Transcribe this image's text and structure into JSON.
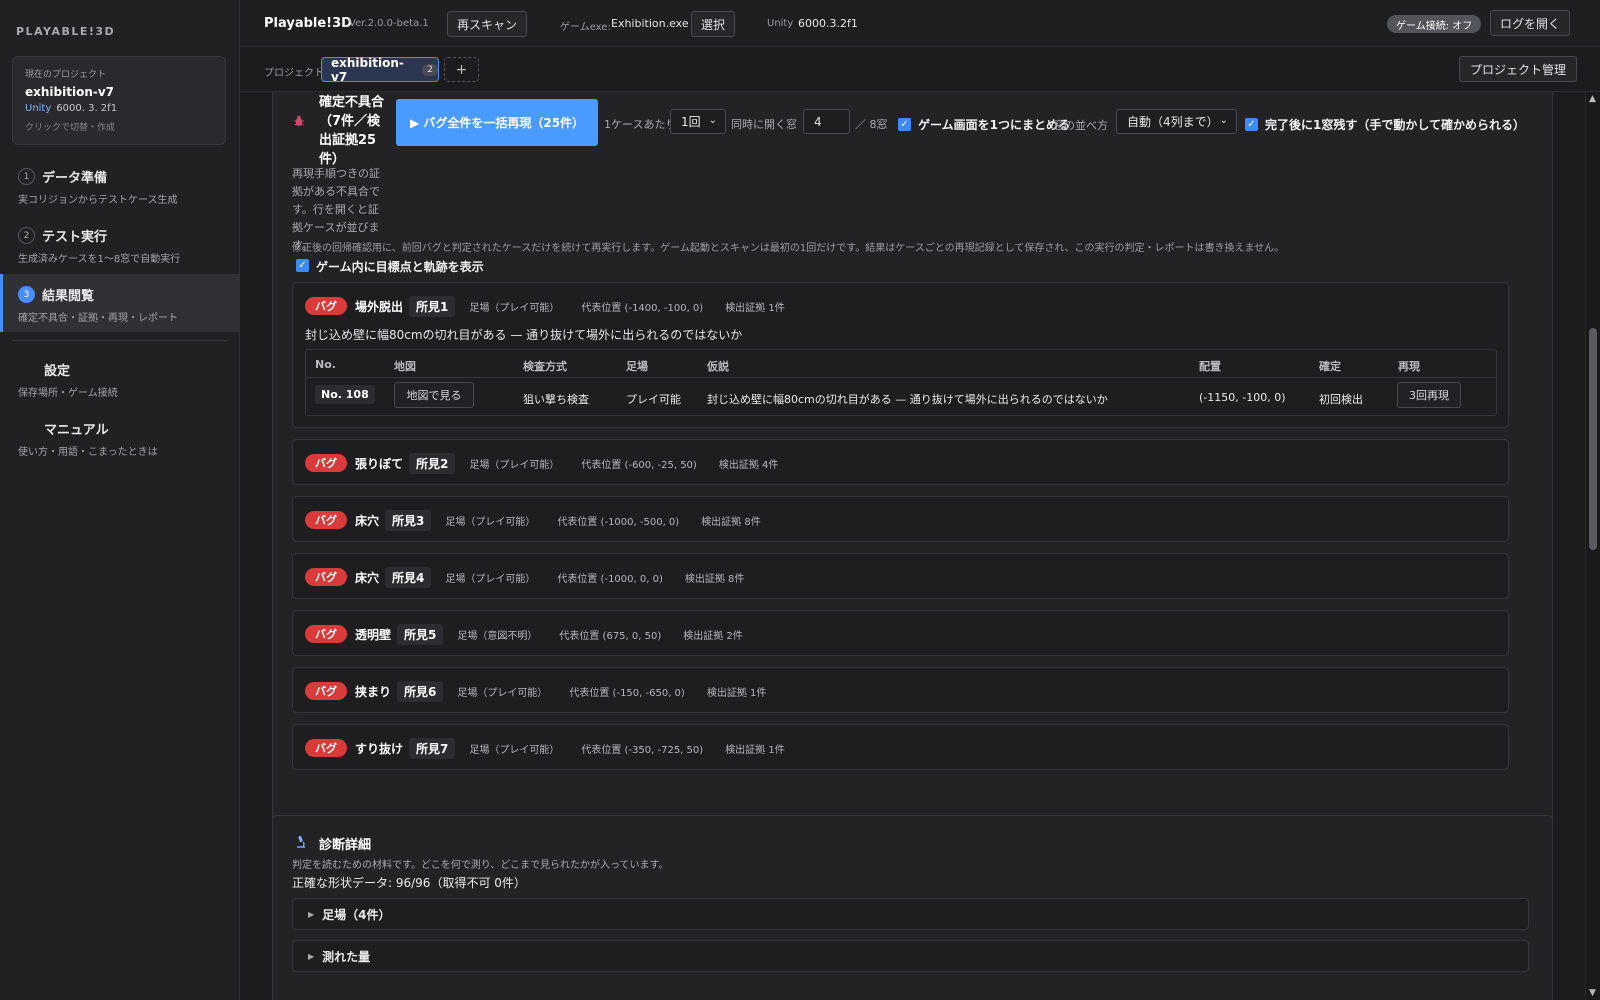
{
  "app": {
    "brand": "PLAYABLE!3D",
    "title": "Playable!3D",
    "version": "Ver.2.0.0-beta.1"
  },
  "header": {
    "rescan_label": "再スキャン",
    "game_exe_label": "ゲームexe:",
    "game_exe_value": "Exhibition.exe",
    "select_label": "選択",
    "unity_label": "Unity",
    "unity_value": "6000.3.2f1",
    "connection_badge": "ゲーム接続: オフ",
    "open_log_label": "ログを開く"
  },
  "project_card": {
    "caption": "現在のプロジェクト",
    "name": "exhibition-v7",
    "unity_label": "Unity",
    "unity_version": "6000. 3. 2f1",
    "hint": "クリックで切替・作成"
  },
  "nav": [
    {
      "num": "1",
      "title": "データ準備",
      "sub": "実コリジョンからテストケース生成"
    },
    {
      "num": "2",
      "title": "テスト実行",
      "sub": "生成済みケースを1〜8窓で自動実行"
    },
    {
      "num": "3",
      "title": "結果閲覧",
      "sub": "確定不具合・証拠・再現・レポート"
    },
    {
      "num": "",
      "title": "設定",
      "sub": "保存場所・ゲーム接続"
    },
    {
      "num": "",
      "title": "マニュアル",
      "sub": "使い方・用語・こまったときは"
    }
  ],
  "project_bar": {
    "label": "プロジェクト",
    "tab_name": "exhibition-v7",
    "tab_count": "2",
    "add_label": "+",
    "manage_label": "プロジェクト管理"
  },
  "bugs_section": {
    "icon": "bug-icon",
    "title": "確定不具合（7件／検出証拠25件）",
    "description": "再現手順つきの証拠がある不具合です。行を開くと証拠ケースが並びます。",
    "replay_all_label": "▶ バグ全件を一括再現（25件）",
    "per_case_label": "1ケースあたり",
    "per_case_value": "1回",
    "windows_label": "同時に開く窓",
    "windows_value": "4",
    "windows_max": "／ 8窓",
    "merge_label": "ゲーム画面を1つにまとめる",
    "arrange_label": "窓の並べ方",
    "arrange_value": "自動（4列まで）",
    "keep_window_label": "完了後に1窓残す（手で動かして確かめられる）",
    "regression_note": "修正後の回帰確認用に、前回バグと判定されたケースだけを続けて再実行します。ゲーム起動とスキャンは最初の1回だけです。結果はケースごとの再現記録として保存され、この実行の判定・レポートは書き換えません。",
    "show_targets_label": "ゲーム内に目標点と軌跡を表示"
  },
  "bugs": [
    {
      "tag": "バグ",
      "kind": "場外脱出",
      "id": "所見1",
      "footing": "足場（プレイ可能）",
      "position": "代表位置 (-1400, -100, 0)",
      "evidence": "検出証拠 1件"
    },
    {
      "tag": "バグ",
      "kind": "張りぼて",
      "id": "所見2",
      "footing": "足場（プレイ可能）",
      "position": "代表位置 (-600, -25, 50)",
      "evidence": "検出証拠 4件"
    },
    {
      "tag": "バグ",
      "kind": "床穴",
      "id": "所見3",
      "footing": "足場（プレイ可能）",
      "position": "代表位置 (-1000, -500, 0)",
      "evidence": "検出証拠 8件"
    },
    {
      "tag": "バグ",
      "kind": "床穴",
      "id": "所見4",
      "footing": "足場（プレイ可能）",
      "position": "代表位置 (-1000, 0, 0)",
      "evidence": "検出証拠 8件"
    },
    {
      "tag": "バグ",
      "kind": "透明壁",
      "id": "所見5",
      "footing": "足場（意図不明）",
      "position": "代表位置 (675, 0, 50)",
      "evidence": "検出証拠 2件"
    },
    {
      "tag": "バグ",
      "kind": "挟まり",
      "id": "所見6",
      "footing": "足場（プレイ可能）",
      "position": "代表位置 (-150, -650, 0)",
      "evidence": "検出証拠 1件"
    },
    {
      "tag": "バグ",
      "kind": "すり抜け",
      "id": "所見7",
      "footing": "足場（プレイ可能）",
      "position": "代表位置 (-350, -725, 50)",
      "evidence": "検出証拠 1件"
    }
  ],
  "bug1_detail": {
    "hypothesis": "封じ込め壁に幅80cmの切れ目がある — 通り抜けて場外に出られるのではないか",
    "columns": [
      "No.",
      "地図",
      "検査方式",
      "足場",
      "仮説",
      "配置",
      "確定",
      "再現"
    ],
    "row": {
      "no": "No. 108",
      "map_button": "地図で見る",
      "method": "狙い撃ち検査",
      "footing": "プレイ可能",
      "hypothesis": "封じ込め壁に幅80cmの切れ目がある — 通り抜けて場外に出られるのではないか",
      "placement": "(-1150, -100, 0)",
      "confirm": "初回検出",
      "replay_button": "3回再現"
    }
  },
  "diagnostics": {
    "icon": "microscope-icon",
    "title": "診断詳細",
    "description": "判定を読むための材料です。どこを何で測り、どこまで見られたかが入っています。",
    "shape_data": "正確な形状データ: 96/96（取得不可 0件）",
    "rows": [
      "足場（4件）",
      "測れた量"
    ]
  },
  "colors": {
    "accent": "#4a9bff",
    "bug_tag": "#d93a3a",
    "background": "#1c1c1e"
  }
}
